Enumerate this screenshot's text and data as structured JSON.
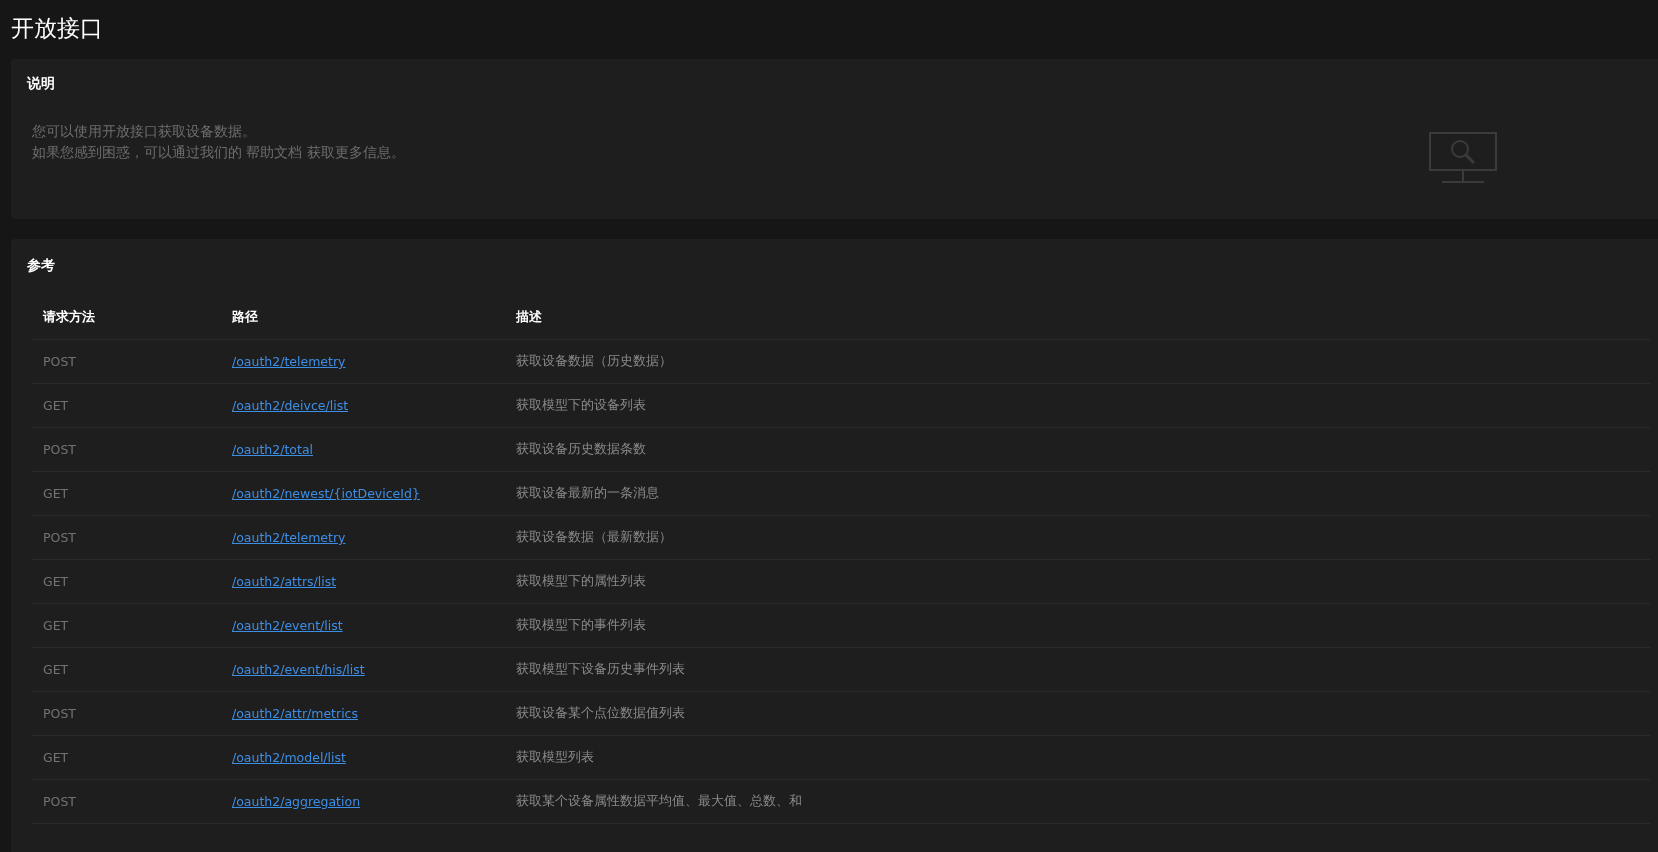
{
  "page_title": "开放接口",
  "intro": {
    "heading": "说明",
    "lines": [
      "您可以使用开放接口获取设备数据。",
      "如果您感到困惑，可以通过我们的 帮助文档 获取更多信息。"
    ]
  },
  "reference": {
    "heading": "参考",
    "table": {
      "columns": [
        "请求方法",
        "路径",
        "描述"
      ],
      "rows": [
        {
          "method": "POST",
          "path": "/oauth2/telemetry",
          "description": "获取设备数据（历史数据）"
        },
        {
          "method": "GET",
          "path": "/oauth2/deivce/list",
          "description": "获取模型下的设备列表"
        },
        {
          "method": "POST",
          "path": "/oauth2/total",
          "description": "获取设备历史数据条数"
        },
        {
          "method": "GET",
          "path": "/oauth2/newest/{iotDeviceId}",
          "description": "获取设备最新的一条消息"
        },
        {
          "method": "POST",
          "path": "/oauth2/telemetry",
          "description": "获取设备数据（最新数据）"
        },
        {
          "method": "GET",
          "path": "/oauth2/attrs/list",
          "description": "获取模型下的属性列表"
        },
        {
          "method": "GET",
          "path": "/oauth2/event/list",
          "description": "获取模型下的事件列表"
        },
        {
          "method": "GET",
          "path": "/oauth2/event/his/list",
          "description": "获取模型下设备历史事件列表"
        },
        {
          "method": "POST",
          "path": "/oauth2/attr/metrics",
          "description": "获取设备某个点位数据值列表"
        },
        {
          "method": "GET",
          "path": "/oauth2/model/list",
          "description": "获取模型列表"
        },
        {
          "method": "POST",
          "path": "/oauth2/aggregation",
          "description": "获取某个设备属性数据平均值、最大值、总数、和"
        }
      ]
    }
  }
}
